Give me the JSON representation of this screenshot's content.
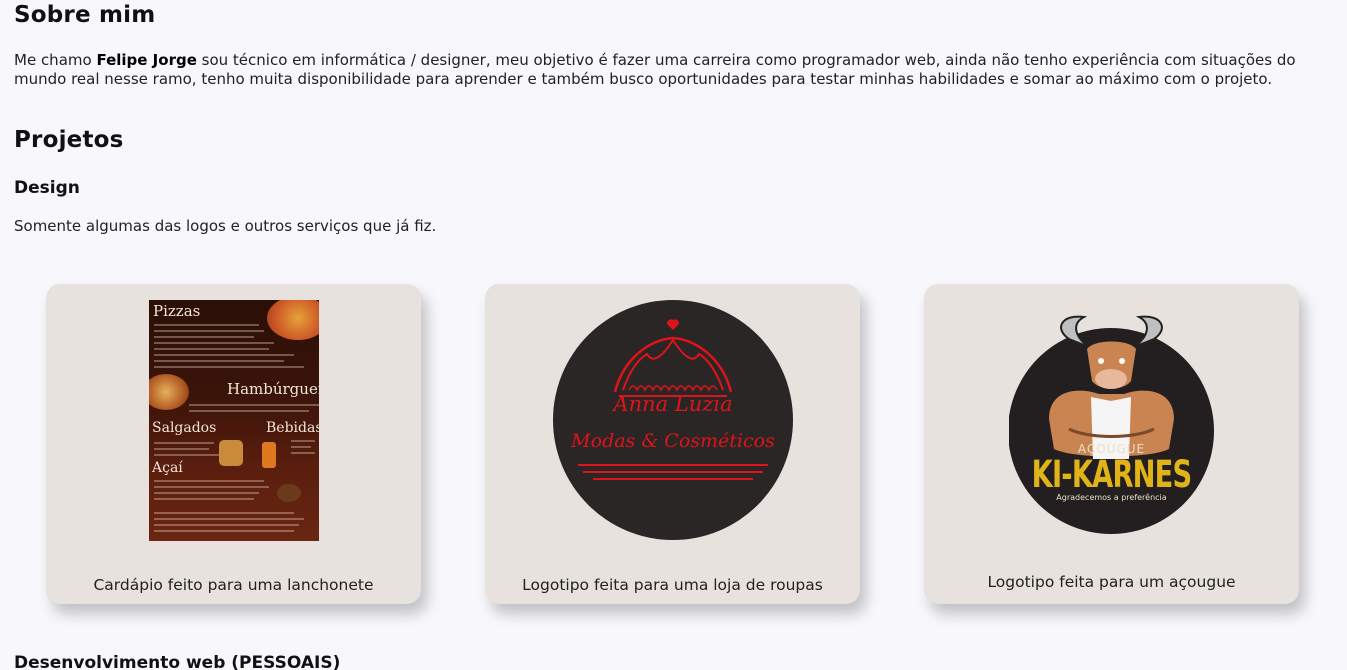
{
  "about": {
    "heading": "Sobre mim",
    "intro": "Me chamo ",
    "name": "Felipe Jorge",
    "text": " sou técnico em informática / designer, meu objetivo é fazer uma carreira como programador web, ainda não tenho experiência com situações do mundo real nesse ramo, tenho muita disponibilidade para aprender e também busco oportunidades para testar minhas habilidades e somar ao máximo com o projeto."
  },
  "projects": {
    "heading": "Projetos",
    "design": {
      "heading": "Design",
      "lead": "Somente algumas das logos e outros serviços que já fiz.",
      "cards": [
        {
          "caption": "Cardápio feito para uma lanchonete",
          "menu": {
            "pizzas": "Pizzas",
            "hamburguers": "Hambúrguers",
            "salgados": "Salgados",
            "bebidas": "Bebidas",
            "acai": "Açaí"
          }
        },
        {
          "caption": "Logotipo feita para uma loja de roupas",
          "logo_line1": "Anna Luzia",
          "logo_line2": "Modas & Cosméticos"
        },
        {
          "caption": "Logotipo feita para um açougue",
          "logo_top": "AÇOUGUE",
          "logo_name": "KI-KARNES",
          "logo_tag": "Agradecemos a preferência"
        }
      ]
    },
    "web": {
      "heading": "Desenvolvimento web (PESSOAIS)"
    }
  },
  "colors": {
    "background": "#f8f7fc",
    "card": "#e7e2de",
    "accent_red": "#e0131a",
    "accent_yellow": "#e0b318"
  }
}
